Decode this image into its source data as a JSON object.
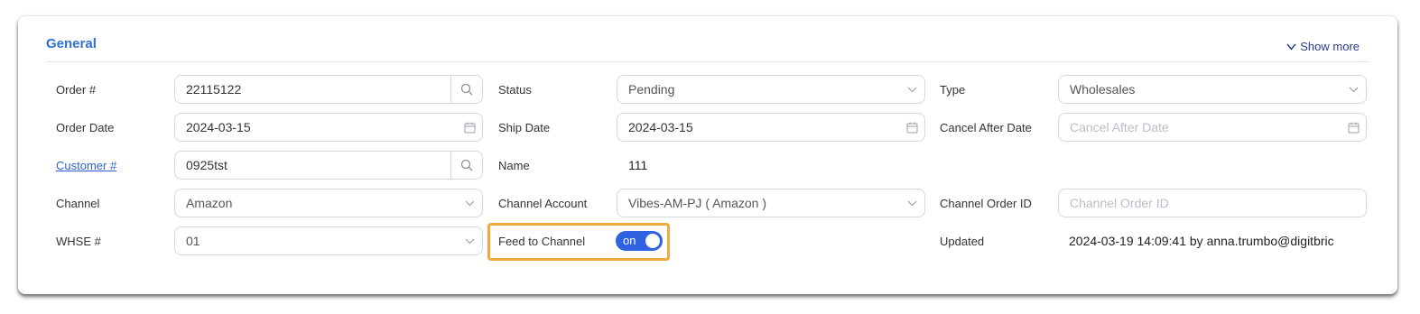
{
  "section": {
    "title": "General",
    "show_more": "Show more"
  },
  "col1": {
    "order_no": {
      "label": "Order #",
      "value": "22115122"
    },
    "order_date": {
      "label": "Order Date",
      "value": "2024-03-15"
    },
    "customer_no": {
      "label": "Customer #",
      "value": "0925tst"
    },
    "channel": {
      "label": "Channel",
      "value": "Amazon"
    },
    "whse_no": {
      "label": "WHSE #",
      "value": "01"
    }
  },
  "col2": {
    "status": {
      "label": "Status",
      "value": "Pending"
    },
    "ship_date": {
      "label": "Ship Date",
      "value": "2024-03-15"
    },
    "name": {
      "label": "Name",
      "value": "111"
    },
    "channel_account": {
      "label": "Channel Account",
      "value": "Vibes-AM-PJ ( Amazon )"
    },
    "feed_to_channel": {
      "label": "Feed to Channel",
      "toggle": "on"
    }
  },
  "col3": {
    "type": {
      "label": "Type",
      "value": "Wholesales"
    },
    "cancel_after_date": {
      "label": "Cancel After Date",
      "placeholder": "Cancel After Date"
    },
    "channel_order_id": {
      "label": "Channel Order ID",
      "placeholder": "Channel Order ID"
    },
    "updated": {
      "label": "Updated",
      "value": "2024-03-19 14:09:41 by anna.trumbo@digitbric"
    }
  },
  "colors": {
    "accent": "#2f62e0",
    "title": "#2f6fd6",
    "highlight": "#f0a93a"
  },
  "icons": [
    "search-icon",
    "calendar-icon",
    "chevron-down-icon"
  ]
}
